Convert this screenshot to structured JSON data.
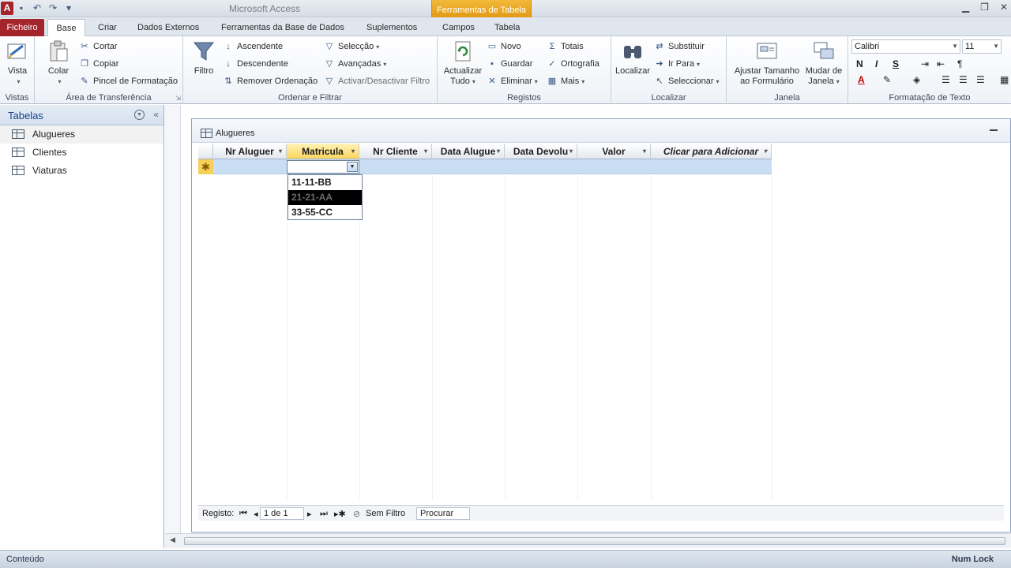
{
  "titlebar": {
    "app_letter": "A",
    "title": "Microsoft Access",
    "context_tab_title": "Ferramentas de Tabela"
  },
  "tabs": {
    "file": "Ficheiro",
    "items": [
      "Base",
      "Criar",
      "Dados Externos",
      "Ferramentas da Base de Dados",
      "Suplementos",
      "Campos",
      "Tabela"
    ]
  },
  "ribbon": {
    "vistas": {
      "label": "Vistas",
      "vista": "Vista"
    },
    "clipboard": {
      "label": "Área de Transferência",
      "paste": "Colar",
      "cut": "Cortar",
      "copy": "Copiar",
      "format_painter": "Pincel de Formatação"
    },
    "sort_filter": {
      "label": "Ordenar e Filtrar",
      "filter": "Filtro",
      "ascending": "Ascendente",
      "descending": "Descendente",
      "remove_sort": "Remover Ordenação",
      "selection": "Selecção",
      "advanced": "Avançadas",
      "toggle_filter": "Activar/Desactivar Filtro"
    },
    "records": {
      "label": "Registos",
      "refresh_line1": "Actualizar",
      "refresh_line2": "Tudo",
      "new": "Novo",
      "save": "Guardar",
      "delete": "Eliminar",
      "totals": "Totais",
      "spelling": "Ortografia",
      "more": "Mais"
    },
    "find": {
      "label": "Localizar",
      "find": "Localizar",
      "replace": "Substituir",
      "goto": "Ir Para",
      "select": "Seleccionar"
    },
    "window": {
      "label": "Janela",
      "fit_line1": "Ajustar Tamanho",
      "fit_line2": "ao Formulário",
      "switch_line1": "Mudar de",
      "switch_line2": "Janela"
    },
    "text_format": {
      "label": "Formatação de Texto",
      "font": "Calibri",
      "size": "11",
      "bold": "N",
      "italic": "I",
      "underline": "S"
    }
  },
  "navpane": {
    "title": "Tabelas",
    "items": [
      "Alugueres",
      "Clientes",
      "Viaturas"
    ]
  },
  "document": {
    "title": "Alugueres",
    "columns": [
      "Nr Aluguer",
      "Matricula",
      "Nr Cliente",
      "Data Alugue",
      "Data Devolu",
      "Valor",
      "Clicar para Adicionar"
    ],
    "new_row_marker": "✱",
    "dropdown_options": [
      "11-11-BB",
      "21-21-AA",
      "33-55-CC"
    ],
    "highlighted_option_index": 1
  },
  "record_nav": {
    "label": "Registo:",
    "current": "1 de 1",
    "filter": "Sem Filtro",
    "search": "Procurar"
  },
  "statusbar": {
    "left": "Conteúdo",
    "right": "Num Lock"
  },
  "colors": {
    "file_tab": "#a4262c",
    "context_tab": "#e29a15",
    "selected_column": "#fbd55c",
    "new_row": "#c9def5"
  }
}
